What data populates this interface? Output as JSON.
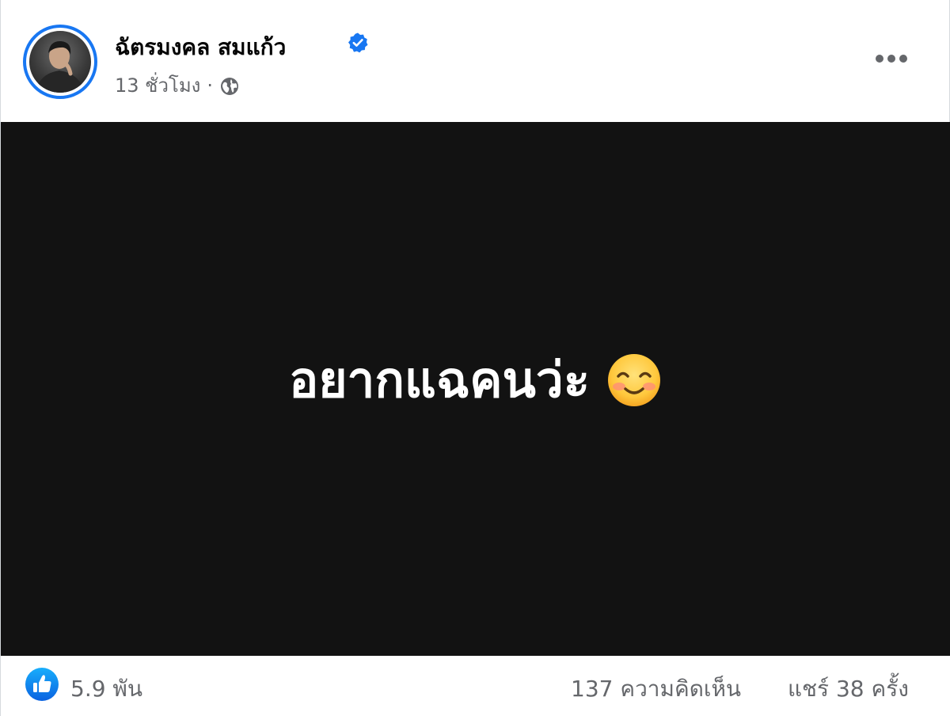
{
  "post": {
    "author": {
      "name": "ฉัตรมงคล สมแก้ว",
      "verified": true
    },
    "meta": {
      "time": "13 ชั่วโมง",
      "separator": "·",
      "audience_icon": "globe-icon"
    },
    "more_icon": "more-horizontal-icon",
    "status_text": "อยากแฉคนว่ะ",
    "status_emoji": "smiling-face-icon",
    "background_color": "#121212"
  },
  "footer": {
    "reaction_icon": "like-icon",
    "reactions": "5.9 พัน",
    "comments": "137 ความคิดเห็น",
    "shares": "แชร์ 38 ครั้ง"
  },
  "colors": {
    "accent": "#1877f2",
    "secondary_text": "#65676b",
    "primary_text": "#050505"
  }
}
